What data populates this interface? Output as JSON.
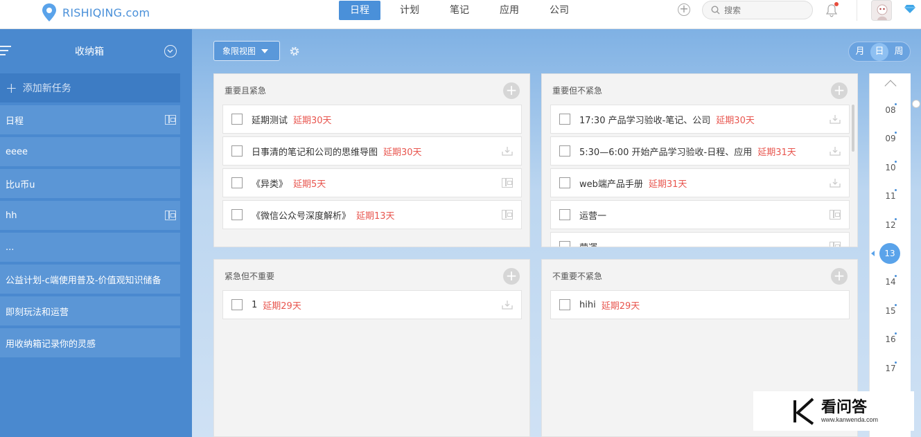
{
  "header": {
    "logo_text": "RISHIQING.com",
    "nav": [
      "日程",
      "计划",
      "笔记",
      "应用",
      "公司"
    ],
    "nav_active": 0,
    "search_placeholder": "搜索",
    "icons": [
      "add-circle-icon",
      "search-icon",
      "bell-icon",
      "avatar",
      "diamond-icon"
    ]
  },
  "sidebar": {
    "title": "收纳箱",
    "add_task": "添加新任务",
    "items": [
      {
        "label": "日程",
        "has_board_icon": true
      },
      {
        "label": "eeee",
        "has_board_icon": false
      },
      {
        "label": "比u币u",
        "has_board_icon": false
      },
      {
        "label": "hh",
        "has_board_icon": true
      },
      {
        "label": "...",
        "has_board_icon": false
      },
      {
        "label": "公益计划-c端使用普及-价值观知识储备",
        "has_board_icon": false
      },
      {
        "label": "即刻玩法和运营",
        "has_board_icon": false
      },
      {
        "label": "用收纳箱记录你的灵感",
        "has_board_icon": false
      }
    ]
  },
  "toolbar": {
    "view_label": "象限视图",
    "segments": [
      "月",
      "日",
      "周"
    ],
    "segment_active": 1
  },
  "quadrants": [
    {
      "title": "重要且紧急",
      "tasks": [
        {
          "text": "延期测试",
          "delay": "延期30天",
          "icon": ""
        },
        {
          "text": "日事清的笔记和公司的思维导图",
          "delay": "延期30天",
          "icon": "download-icon"
        },
        {
          "text": "《异类》",
          "delay": "延期5天",
          "icon": "board-icon"
        },
        {
          "text": "《微信公众号深度解析》",
          "delay": "延期13天",
          "icon": "board-icon"
        }
      ]
    },
    {
      "title": "重要但不紧急",
      "tasks": [
        {
          "text": "17:30 产品学习验收-笔记、公司",
          "delay": "延期30天",
          "icon": "download-icon"
        },
        {
          "text": "5:30—6:00 开始产品学习验收-日程、应用",
          "delay": "延期31天",
          "icon": "download-icon"
        },
        {
          "text": "web端产品手册",
          "delay": "延期31天",
          "icon": "download-icon"
        },
        {
          "text": "运营一",
          "delay": "",
          "icon": "board-icon"
        },
        {
          "text": "营運",
          "delay": "",
          "icon": "board-icon"
        }
      ]
    },
    {
      "title": "紧急但不重要",
      "tasks": [
        {
          "text": "1",
          "delay": "延期29天",
          "icon": "download-icon"
        }
      ]
    },
    {
      "title": "不重要不紧急",
      "tasks": [
        {
          "text": "hihi",
          "delay": "延期29天",
          "icon": ""
        }
      ]
    }
  ],
  "timeline": {
    "hours": [
      "08",
      "09",
      "10",
      "11",
      "12",
      "13",
      "14",
      "15",
      "16",
      "17"
    ],
    "current": "13"
  },
  "watermark": {
    "brand": "看问答",
    "url": "www.kanwenda.com"
  },
  "colors": {
    "accent": "#4a90d9",
    "sidebar": "#4a89cf",
    "delay": "#e8554e"
  }
}
